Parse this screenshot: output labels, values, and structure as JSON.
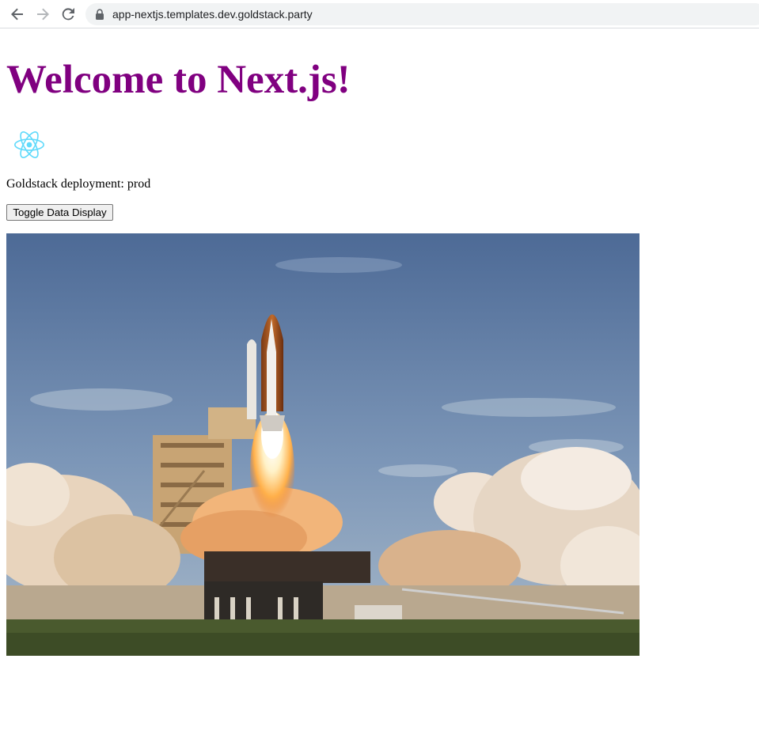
{
  "browser": {
    "url": "app-nextjs.templates.dev.goldstack.party",
    "icons": [
      "back-arrow-icon",
      "forward-arrow-icon",
      "reload-icon",
      "lock-icon"
    ]
  },
  "page": {
    "title": "Welcome to Next.js!",
    "deployment_text": "Goldstack deployment: prod",
    "toggle_button_label": "Toggle Data Display",
    "logo_icon": "react-atom-icon",
    "title_color": "#800080",
    "logo_color": "#61dafb",
    "image_subject": "space shuttle launch"
  }
}
